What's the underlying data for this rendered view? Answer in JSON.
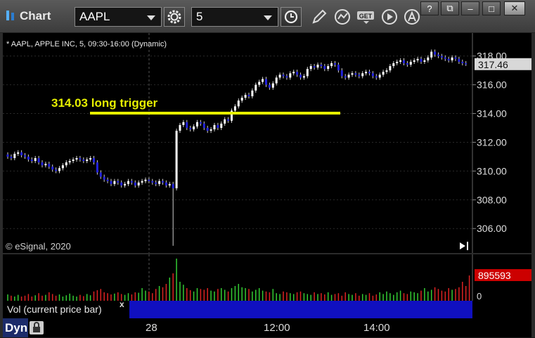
{
  "app": {
    "title": "Chart"
  },
  "toolbar": {
    "symbol": "AAPL",
    "interval": "5"
  },
  "window_buttons": [
    "?",
    "⧉",
    "–",
    "□",
    "✕"
  ],
  "chart": {
    "header": "* AAPL, APPLE INC, 5, 09:30-16:00 (Dynamic)",
    "annotation": "314.03 long trigger",
    "trigger_level": 314.03,
    "copyright": "© eSignal, 2020",
    "last_price": "317.46",
    "colors": {
      "up": "#ffffff",
      "down": "#2222dd",
      "trigger": "#e6f000",
      "grid": "#2a2a2a",
      "price_tag": "#d8d8d8"
    }
  },
  "volume": {
    "last_value": "895593",
    "zero_label": "0",
    "study_label": "Vol (current price bar)",
    "close_label": "x",
    "colors": {
      "up": "#33cc33",
      "down": "#dd2222",
      "tag": "#cc0000"
    }
  },
  "x_axis": {
    "labels": [
      "28",
      "12:00",
      "14:00"
    ]
  },
  "footer": {
    "mode": "Dyn"
  },
  "chart_data": {
    "type": "candlestick",
    "title": "AAPL, APPLE INC, 5, 09:30-16:00 (Dynamic)",
    "y_ticks": [
      "318.00",
      "316.00",
      "314.00",
      "312.00",
      "310.00",
      "308.00",
      "306.00"
    ],
    "ylim": [
      304.3,
      319.6
    ],
    "x_labels": [
      {
        "label": "28",
        "index": 49
      },
      {
        "label": "12:00",
        "index": 84
      },
      {
        "label": "14:00",
        "index": 108
      }
    ],
    "closes": [
      311.0,
      310.9,
      311.2,
      311.3,
      311.1,
      311.0,
      310.8,
      310.7,
      310.9,
      310.6,
      310.4,
      310.5,
      310.3,
      310.1,
      310.0,
      310.2,
      310.4,
      310.6,
      310.7,
      310.8,
      310.9,
      310.8,
      310.7,
      310.8,
      310.9,
      310.6,
      309.9,
      309.6,
      309.4,
      309.3,
      309.1,
      309.3,
      309.2,
      309.0,
      309.1,
      309.3,
      309.2,
      309.0,
      309.2,
      309.3,
      309.4,
      309.3,
      309.2,
      309.1,
      309.3,
      309.2,
      309.0,
      309.1,
      308.8,
      312.8,
      313.2,
      313.4,
      313.0,
      312.9,
      313.1,
      313.4,
      313.3,
      313.0,
      312.8,
      312.9,
      313.2,
      313.0,
      313.3,
      313.6,
      313.5,
      314.2,
      314.5,
      314.9,
      315.1,
      315.3,
      315.2,
      315.6,
      316.0,
      316.2,
      316.4,
      316.0,
      315.8,
      316.1,
      316.5,
      316.7,
      316.6,
      316.5,
      316.8,
      316.9,
      316.7,
      316.5,
      316.6,
      317.1,
      317.3,
      317.2,
      317.4,
      317.3,
      317.1,
      317.3,
      317.5,
      317.4,
      317.0,
      316.6,
      316.5,
      316.7,
      316.8,
      316.7,
      316.6,
      316.8,
      316.9,
      316.8,
      316.6,
      316.5,
      316.7,
      316.9,
      317.0,
      317.3,
      317.5,
      317.6,
      317.7,
      317.5,
      317.4,
      317.6,
      317.7,
      317.8,
      317.6,
      317.7,
      317.9,
      318.3,
      318.1,
      318.0,
      317.9,
      317.8,
      317.7,
      317.9,
      317.8,
      317.6,
      317.5,
      317.46
    ],
    "volume_relative": [
      0.15,
      0.12,
      0.1,
      0.14,
      0.1,
      0.12,
      0.16,
      0.1,
      0.13,
      0.18,
      0.12,
      0.14,
      0.2,
      0.16,
      0.12,
      0.15,
      0.1,
      0.13,
      0.17,
      0.12,
      0.1,
      0.14,
      0.11,
      0.16,
      0.13,
      0.22,
      0.25,
      0.28,
      0.2,
      0.18,
      0.15,
      0.17,
      0.2,
      0.16,
      0.14,
      0.18,
      0.15,
      0.2,
      0.19,
      0.3,
      0.24,
      0.22,
      0.18,
      0.28,
      0.35,
      0.32,
      0.4,
      0.55,
      0.65,
      1.0,
      0.45,
      0.38,
      0.3,
      0.25,
      0.22,
      0.3,
      0.28,
      0.26,
      0.3,
      0.24,
      0.22,
      0.28,
      0.3,
      0.26,
      0.22,
      0.3,
      0.35,
      0.4,
      0.32,
      0.3,
      0.28,
      0.22,
      0.26,
      0.3,
      0.24,
      0.22,
      0.2,
      0.28,
      0.18,
      0.16,
      0.22,
      0.2,
      0.18,
      0.16,
      0.2,
      0.22,
      0.18,
      0.16,
      0.14,
      0.2,
      0.16,
      0.18,
      0.15,
      0.2,
      0.14,
      0.16,
      0.18,
      0.12,
      0.2,
      0.16,
      0.14,
      0.18,
      0.12,
      0.16,
      0.14,
      0.18,
      0.12,
      0.15,
      0.2,
      0.16,
      0.22,
      0.18,
      0.14,
      0.2,
      0.24,
      0.18,
      0.16,
      0.22,
      0.2,
      0.18,
      0.24,
      0.3,
      0.22,
      0.26,
      0.32,
      0.28,
      0.24,
      0.22,
      0.3,
      0.26,
      0.28,
      0.32,
      0.45,
      0.35,
      0.6
    ]
  }
}
